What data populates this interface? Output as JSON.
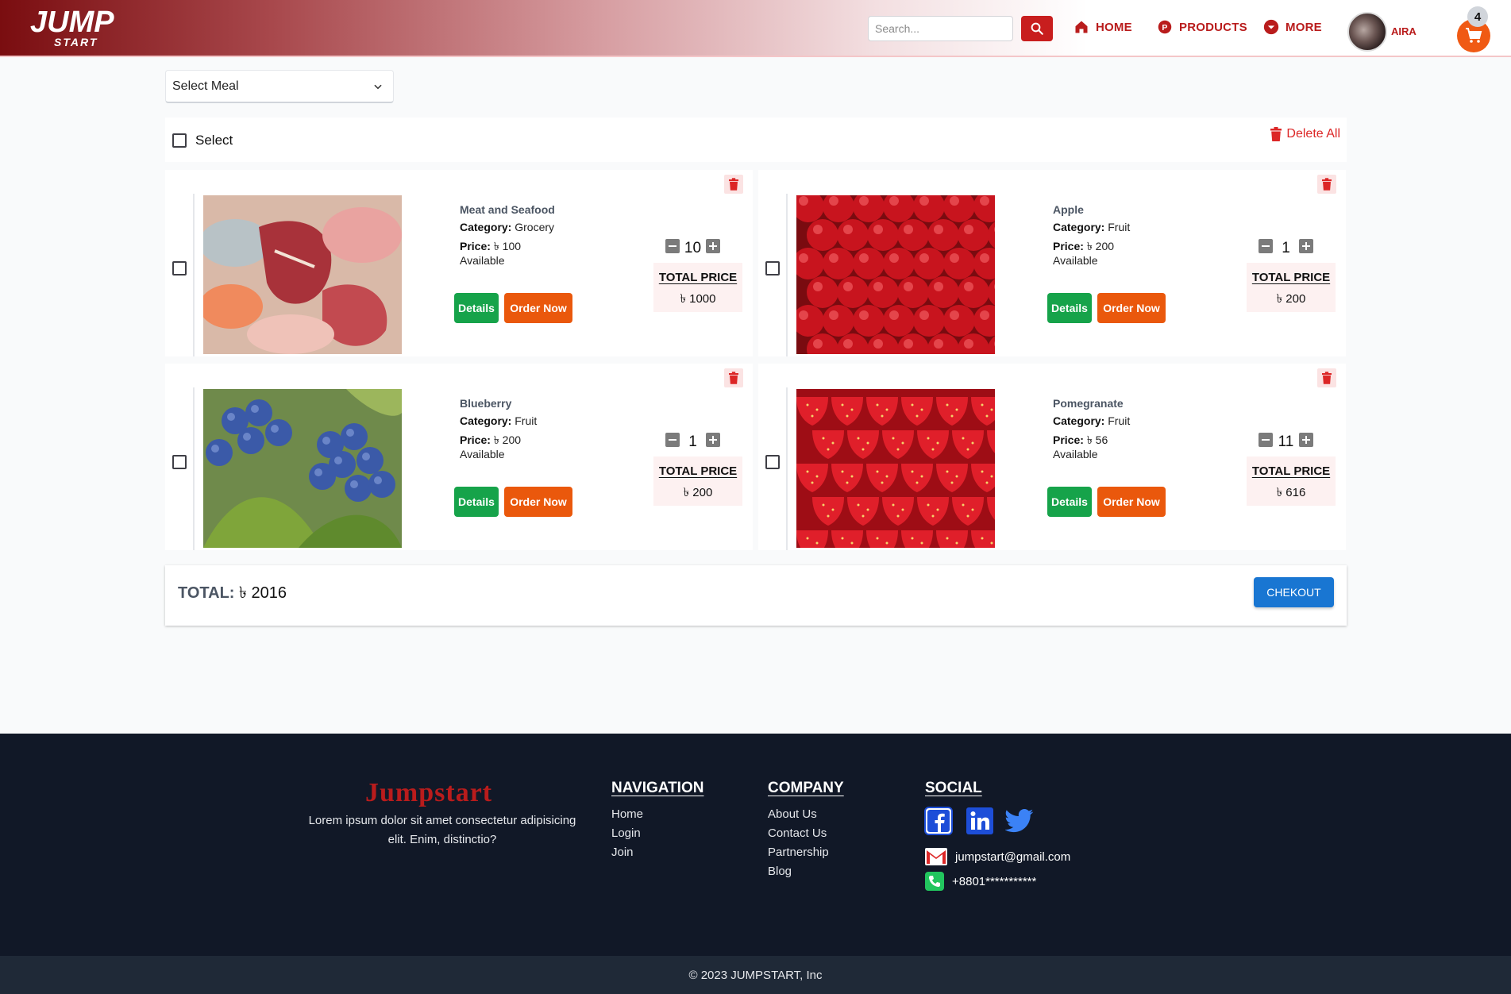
{
  "header": {
    "search_placeholder": "Search...",
    "nav": [
      {
        "label": "HOME",
        "icon": "home-icon"
      },
      {
        "label": "PRODUCTS",
        "icon": "products-icon"
      },
      {
        "label": "MORE",
        "icon": "chevron-down-circle-icon"
      }
    ],
    "user_name": "AIRA",
    "cart_count": "4"
  },
  "meal_select": {
    "value": "Select Meal"
  },
  "select_bar": {
    "select_label": "Select",
    "delete_all_label": "Delete All"
  },
  "items": [
    {
      "name": "Meat and Seafood",
      "category_label": "Category:",
      "category": "Grocery",
      "price_label": "Price:",
      "price": "৳ 100",
      "availability": "Available",
      "details_label": "Details",
      "order_label": "Order Now",
      "quantity": "10",
      "total_label": "TOTAL PRICE",
      "total": "৳ 1000",
      "image": "meat-seafood"
    },
    {
      "name": "Apple",
      "category_label": "Category:",
      "category": "Fruit",
      "price_label": "Price:",
      "price": "৳ 200",
      "availability": "Available",
      "details_label": "Details",
      "order_label": "Order Now",
      "quantity": "1",
      "total_label": "TOTAL PRICE",
      "total": "৳ 200",
      "image": "apples"
    },
    {
      "name": "Blueberry",
      "category_label": "Category:",
      "category": "Fruit",
      "price_label": "Price:",
      "price": "৳ 200",
      "availability": "Available",
      "details_label": "Details",
      "order_label": "Order Now",
      "quantity": "1",
      "total_label": "TOTAL PRICE",
      "total": "৳ 200",
      "image": "blueberries"
    },
    {
      "name": "Pomegranate",
      "category_label": "Category:",
      "category": "Fruit",
      "price_label": "Price:",
      "price": "৳ 56",
      "availability": "Available",
      "details_label": "Details",
      "order_label": "Order Now",
      "quantity": "11",
      "total_label": "TOTAL PRICE",
      "total": "৳ 616",
      "image": "strawberries"
    }
  ],
  "summary": {
    "total_label": "TOTAL:",
    "total_value": "৳ 2016",
    "checkout_label": "CHEKOUT"
  },
  "footer": {
    "brand": "Jumpstart",
    "description": "Lorem ipsum dolor sit amet consectetur adipisicing elit. Enim, distinctio?",
    "navigation": {
      "title": "NAVIGATION",
      "links": [
        "Home",
        "Login",
        "Join"
      ]
    },
    "company": {
      "title": "COMPANY",
      "links": [
        "About Us",
        "Contact Us",
        "Partnership",
        "Blog"
      ]
    },
    "social": {
      "title": "SOCIAL",
      "icons": [
        "facebook-icon",
        "linkedin-icon",
        "twitter-icon"
      ],
      "email": "jumpstart@gmail.com",
      "phone": "+8801***********"
    },
    "copyright": "© 2023 JUMPSTART, Inc"
  },
  "colors": {
    "brand_red": "#b91c1c",
    "order_orange": "#ea580c",
    "details_green": "#16a34a",
    "checkout_blue": "#1976d2",
    "footer_bg": "#111827"
  }
}
